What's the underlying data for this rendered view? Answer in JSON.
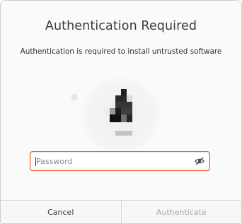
{
  "dialog": {
    "title": "Authentication Required",
    "message": "Authentication is required to install untrusted software"
  },
  "avatar": {
    "icon": "user-avatar-icon"
  },
  "password": {
    "placeholder": "Password",
    "value": "",
    "reveal_icon": "eye-slash-icon"
  },
  "buttons": {
    "cancel_label": "Cancel",
    "authenticate_label": "Authenticate"
  },
  "colors": {
    "accent": "#e95420",
    "title_text": "#3a3a3a",
    "disabled_text": "#a6a6a6"
  }
}
